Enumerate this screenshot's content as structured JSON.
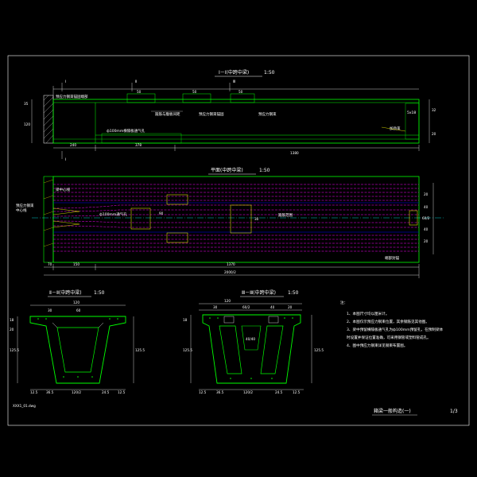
{
  "drawing": {
    "background": "#000000",
    "colors": {
      "frame": "#ffffff",
      "outline": "#00ff00",
      "dimension": "#ffffff",
      "tendon": "#ff00ff",
      "detail": "#ffff00",
      "blue": "#0000ff",
      "cyan": "#00ffff"
    },
    "section_1": {
      "title": "Ⅰ－Ⅰ(中跨中梁)",
      "scale": "1:50",
      "marks_top": [
        "Ⅰ",
        "Ⅱ",
        "Ⅲ"
      ],
      "segment_dims": [
        "50",
        "50",
        "50"
      ],
      "bottom_dims": [
        "240",
        "378",
        "1380"
      ],
      "left_dims": [
        "35",
        "120"
      ],
      "right_dims": [
        "32",
        "20"
      ],
      "labels": [
        "箍筋与腹板间距",
        "预应力钢束锚固",
        "预应力钢束",
        "预应力钢束锚固端部",
        "加劲束",
        "ф100mm横隔板通气孔",
        "5x18"
      ]
    },
    "section_plan": {
      "title": "平面(中跨中梁)",
      "scale": "1:50",
      "bottom_dims": [
        "70",
        "150",
        "1370",
        "2000/2"
      ],
      "right_dims": [
        "20",
        "40",
        "60/2",
        "40",
        "20"
      ],
      "labels": [
        "ф100mm通气孔",
        "预应力钢束",
        "中心线",
        "90",
        "30",
        "箍筋范围",
        "梁中心线",
        "端部封锚"
      ]
    },
    "section_2": {
      "title": "Ⅱ－Ⅱ(中跨中梁)",
      "scale": "1:50",
      "top_dims": [
        "120",
        "30",
        "60"
      ],
      "bottom_dims": [
        "12.5",
        "36.5",
        "120/2",
        "24.5",
        "12.5"
      ],
      "left_dims": [
        "18",
        "20",
        "125.5"
      ],
      "right_dims": [
        "125.5"
      ]
    },
    "section_3": {
      "title": "Ⅲ－Ⅲ(中跨中梁)",
      "scale": "1:50",
      "top_dims": [
        "120",
        "30",
        "60/2",
        "40",
        "20"
      ],
      "bottom_dims": [
        "12.5",
        "36.5",
        "120/2",
        "24.5",
        "12.5"
      ],
      "left_dims": [
        "18",
        "125.5"
      ],
      "right_dims": [
        "125.5"
      ],
      "inner_label": "40/40"
    },
    "notes": {
      "header": "注：",
      "items": [
        "1、本图尺寸均以厘米计。",
        "2、本图仅示预应力钢束位置，其余钢筋见其他图。",
        "3、梁中预留横隔板通气孔为ф100mm预留孔，在预制梁体",
        "   时设置并保证位置准确，可采用钢管或塑料管成孔。",
        "4、图中预应力钢束详见钢束布置图。"
      ]
    },
    "footer": {
      "drawing_title": "箱梁一般构造(一)",
      "sheet": "1/3",
      "filename": "XXX1_01.dwg"
    }
  }
}
